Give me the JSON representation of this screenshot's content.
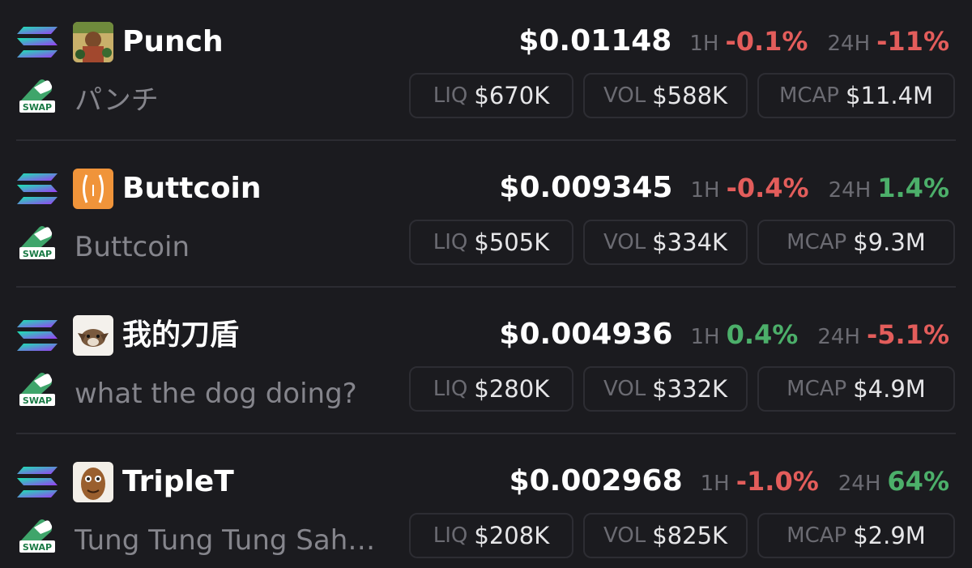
{
  "colors": {
    "background": "#1b1b1f",
    "negative": "#e35d5b",
    "positive": "#4caf6a",
    "muted": "#6b6b72",
    "pill_border": "#2d2d33"
  },
  "labels": {
    "h1": "1H",
    "h24": "24H",
    "liq": "LIQ",
    "vol": "VOL",
    "mcap": "MCAP",
    "swap_badge": "SWAP"
  },
  "tokens": [
    {
      "name": "Punch",
      "subname": "パンチ",
      "price": "$0.01148",
      "change_1h": "-0.1%",
      "change_1h_dir": "neg",
      "change_24h": "-11%",
      "change_24h_dir": "neg",
      "liq": "$670K",
      "vol": "$588K",
      "mcap": "$11.4M",
      "avatar_icon": "punch-art-avatar"
    },
    {
      "name": "Buttcoin",
      "subname": "Buttcoin",
      "price": "$0.009345",
      "change_1h": "-0.4%",
      "change_1h_dir": "neg",
      "change_24h": "1.4%",
      "change_24h_dir": "pos",
      "liq": "$505K",
      "vol": "$334K",
      "mcap": "$9.3M",
      "avatar_icon": "buttcoin-avatar"
    },
    {
      "name": "我的刀盾",
      "subname": "what the dog doing?",
      "price": "$0.004936",
      "change_1h": "0.4%",
      "change_1h_dir": "pos",
      "change_24h": "-5.1%",
      "change_24h_dir": "neg",
      "liq": "$280K",
      "vol": "$332K",
      "mcap": "$4.9M",
      "avatar_icon": "dog-avatar"
    },
    {
      "name": "TripleT",
      "subname": "Tung Tung Tung Sah…",
      "price": "$0.002968",
      "change_1h": "-1.0%",
      "change_1h_dir": "neg",
      "change_24h": "64%",
      "change_24h_dir": "pos",
      "liq": "$208K",
      "vol": "$825K",
      "mcap": "$2.9M",
      "avatar_icon": "wooden-figure-avatar"
    }
  ]
}
